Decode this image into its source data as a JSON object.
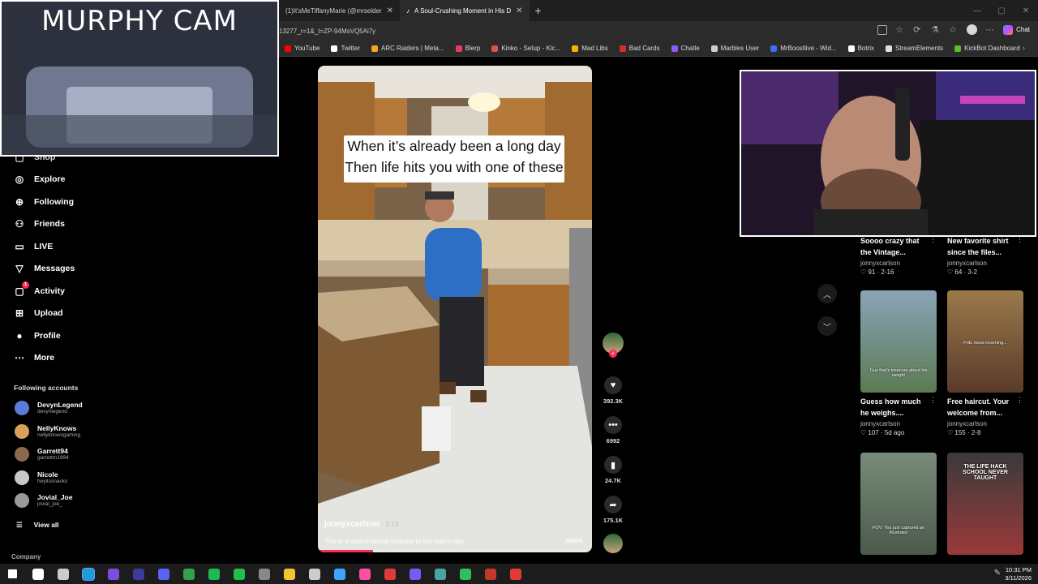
{
  "browser": {
    "tabs": [
      {
        "label": "(1)It'sMeTiffanyMarie (@mrselder",
        "active": false
      },
      {
        "label": "A Soul-Crushing Moment in His D",
        "active": true
      }
    ],
    "url": "13277_r=1&_t=ZP-94MsVQ5Ai7y",
    "chat_label": "Chat",
    "bookmarks": [
      {
        "label": "YouTube",
        "color": "#ff0000"
      },
      {
        "label": "Twitter",
        "color": "#ffffff"
      },
      {
        "label": "ARC Raiders | Meta...",
        "color": "#f4a623"
      },
      {
        "label": "Blerp",
        "color": "#e63b5c"
      },
      {
        "label": "Kinko - Setup - Kic...",
        "color": "#d9534f"
      },
      {
        "label": "Mad Libs",
        "color": "#f5b400"
      },
      {
        "label": "Bad Cards",
        "color": "#d62c2c"
      },
      {
        "label": "Chatle",
        "color": "#8e5cf7"
      },
      {
        "label": "Marbles User",
        "color": "#cccccc"
      },
      {
        "label": "MrBoostlive - Wid...",
        "color": "#3b6ef5"
      },
      {
        "label": "Botrix",
        "color": "#ffffff"
      },
      {
        "label": "StreamElements",
        "color": "#e0e0e0"
      },
      {
        "label": "KickBot Dashboard",
        "color": "#53c22b"
      }
    ]
  },
  "sidebar": {
    "partial_item": "Shop",
    "items": [
      {
        "label": "Explore",
        "icon": "compass-icon",
        "glyph": "◎"
      },
      {
        "label": "Following",
        "icon": "following-icon",
        "glyph": "⊕"
      },
      {
        "label": "Friends",
        "icon": "friends-icon",
        "glyph": "⚇"
      },
      {
        "label": "LIVE",
        "icon": "live-icon",
        "glyph": "▭"
      },
      {
        "label": "Messages",
        "icon": "messages-icon",
        "glyph": "▽"
      },
      {
        "label": "Activity",
        "icon": "activity-icon",
        "glyph": "▢",
        "badge": "1"
      },
      {
        "label": "Upload",
        "icon": "upload-icon",
        "glyph": "⊞"
      },
      {
        "label": "Profile",
        "icon": "profile-icon",
        "glyph": "●"
      },
      {
        "label": "More",
        "icon": "more-icon",
        "glyph": "⋯"
      }
    ],
    "following_heading": "Following accounts",
    "accounts": [
      {
        "name": "DevynLegend",
        "handle": "devynlegend",
        "color": "#5a7bd8"
      },
      {
        "name": "NellyKnows",
        "handle": "nellyknowsgaming",
        "color": "#d8a25a"
      },
      {
        "name": "Garrett94",
        "handle": "garrettm1994",
        "color": "#8a6a4a"
      },
      {
        "name": "Nicole",
        "handle": "heyitssnacks",
        "color": "#c8c8c8"
      },
      {
        "name": "Jovial_Joe",
        "handle": "jovial_joe_",
        "color": "#9a9a9a"
      }
    ],
    "view_all": "View all",
    "company": "Company"
  },
  "video": {
    "caption_line1": "When it’s already been a long day",
    "caption_line2": "Then life hits you with one of these",
    "author": "jonnyxcarlson",
    "date": "· 2-13",
    "description": "This is a soul crushing moment in this man's day.",
    "more": "more",
    "progress": 0.2
  },
  "actions": {
    "likes": "392.3K",
    "comments": "6992",
    "saves": "24.7K",
    "shares": "175.1K"
  },
  "overlays": {
    "murphy_title": "MURPHY CAM"
  },
  "recommended": [
    {
      "title1": "Soooo crazy that",
      "title2": "the Vintage...",
      "user": "jonnyxcarlson",
      "meta": "♡ 91 · 2-16"
    },
    {
      "title1": "New favorite shirt",
      "title2": "since the files...",
      "user": "jonnyxcarlson",
      "meta": "♡ 64 · 3-2"
    },
    {
      "title1": "Guess how much",
      "title2": "he weighs....",
      "user": "jonnyxcarlson",
      "meta": "♡ 107 · 5d ago",
      "thumb_caption": "Guy that's insecure about his weight",
      "thumb_color": "#5b7a52"
    },
    {
      "title1": "Free haircut. Your",
      "title2": "welcome from...",
      "user": "jonnyxcarlson",
      "meta": "♡ 155 · 2-8",
      "thumb_caption": "Fritz mess incoming...",
      "thumb_color": "#7a5a3a"
    },
    {
      "thumb_caption": "POV: You just captured an Illustrator",
      "thumb_color": "#5a6a5a"
    },
    {
      "thumb_caption": "THE LIFE HACK SCHOOL NEVER TAUGHT",
      "thumb_color": "#4a4a4a"
    }
  ],
  "clock": {
    "time": "10:31 PM",
    "date": "3/11/2026"
  },
  "taskbar": [
    {
      "icon": "windows-start-icon",
      "color": "#ffffff"
    },
    {
      "icon": "search-icon",
      "color": "#ffffff"
    },
    {
      "icon": "task-view-icon",
      "color": "#cccccc"
    },
    {
      "icon": "edge-icon",
      "color": "#1f9bd8"
    },
    {
      "icon": "chrome-icon",
      "color": "#7a4de0"
    },
    {
      "icon": "obs-icon",
      "color": "#3b3b9a"
    },
    {
      "icon": "discord-icon",
      "color": "#5865f2"
    },
    {
      "icon": "app-green-icon",
      "color": "#35a04a"
    },
    {
      "icon": "spotify-icon",
      "color": "#1db954"
    },
    {
      "icon": "app-lime-icon",
      "color": "#1fbf4a"
    },
    {
      "icon": "app-gray-icon",
      "color": "#888888"
    },
    {
      "icon": "folder-icon",
      "color": "#f1c232"
    },
    {
      "icon": "app-pale-icon",
      "color": "#cccccc"
    },
    {
      "icon": "app-blue-icon",
      "color": "#3da5ff"
    },
    {
      "icon": "app-pink-icon",
      "color": "#ff4fa3"
    },
    {
      "icon": "app-red-icon",
      "color": "#e03a3a"
    },
    {
      "icon": "app-purple-icon",
      "color": "#7a5af5"
    },
    {
      "icon": "app-teal-icon",
      "color": "#4aa3a3"
    },
    {
      "icon": "app-green2-icon",
      "color": "#2fbf5a"
    },
    {
      "icon": "app-dark-red-icon",
      "color": "#c0392b"
    },
    {
      "icon": "app-red2-icon",
      "color": "#e53935"
    }
  ]
}
